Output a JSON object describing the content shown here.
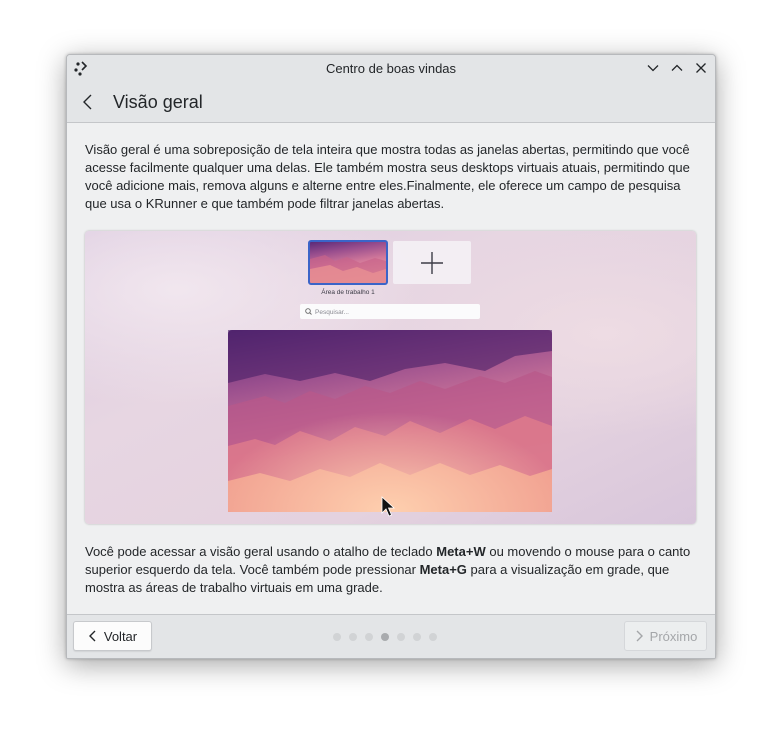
{
  "window": {
    "title": "Centro de boas vindas",
    "controls": [
      "minimize",
      "maximize",
      "close"
    ]
  },
  "header": {
    "title": "Visão geral"
  },
  "content": {
    "intro": "Visão geral é uma sobreposição de tela inteira que mostra todas as janelas abertas, permitindo que você acesse facilmente qualquer uma delas. Ele também mostra seus desktops virtuais atuais, permitindo que você adicione mais, remova alguns e alterne entre eles.Finalmente, ele oferece um campo de pesquisa que usa o KRunner e que também pode filtrar janelas abertas.",
    "shortcut_text": {
      "part1": "Você pode acessar a visão geral usando o atalho de teclado ",
      "key1": "Meta+W",
      "part2": " ou movendo o mouse para o canto superior esquerdo da tela. Você também pode pressionar ",
      "key2": "Meta+G",
      "part3": " para a visualização em grade, que mostra as áreas de trabalho virtuais em uma grade."
    }
  },
  "preview": {
    "desktop_label": "Área de trabalho 1",
    "search_placeholder": "Pesquisar..."
  },
  "footer": {
    "back_label": "Voltar",
    "next_label": "Próximo",
    "page_count": 7,
    "current_page": 4
  },
  "colors": {
    "accent": "#3daee9",
    "text": "#232629",
    "window_bg": "#eff0f1",
    "header_bg": "#e3e5e7"
  },
  "icons": [
    "app-icon",
    "chevron-down-icon",
    "chevron-up-icon",
    "close-icon",
    "back-arrow-icon",
    "chevron-left-icon",
    "chevron-right-icon",
    "plus-icon",
    "search-icon",
    "mouse-cursor-icon"
  ]
}
